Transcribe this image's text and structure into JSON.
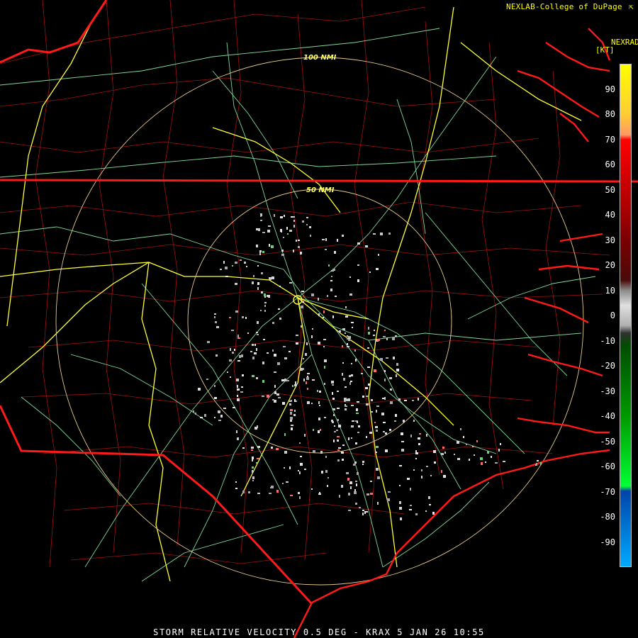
{
  "credit": "NEXLAB-College of DuPage",
  "credit_icon": "external-link-icon",
  "legend": {
    "product_label": "NEXRAD",
    "unit": "[KT]",
    "ticks": [
      90,
      80,
      70,
      60,
      50,
      40,
      30,
      20,
      10,
      0,
      -10,
      -20,
      -30,
      -40,
      -50,
      -60,
      -70,
      -80,
      -90
    ],
    "range_min": -100,
    "range_max": 100,
    "gradient_stops": [
      {
        "value": 100,
        "color": "#ffff00"
      },
      {
        "value": 80,
        "color": "#ffcc33"
      },
      {
        "value": 72,
        "color": "#ff9966"
      },
      {
        "value": 70,
        "color": "#ff0000"
      },
      {
        "value": 45,
        "color": "#b30000"
      },
      {
        "value": 30,
        "color": "#7a0000"
      },
      {
        "value": 14,
        "color": "#4a0a0a"
      },
      {
        "value": 10,
        "color": "#8a8a8a"
      },
      {
        "value": 4,
        "color": "#e0e0e0"
      },
      {
        "value": -4,
        "color": "#b0b0b0"
      },
      {
        "value": -7,
        "color": "#303030"
      },
      {
        "value": -12,
        "color": "#004d00"
      },
      {
        "value": -40,
        "color": "#009900"
      },
      {
        "value": -68,
        "color": "#00ff33"
      },
      {
        "value": -70,
        "color": "#0044aa"
      },
      {
        "value": -100,
        "color": "#00aaff"
      }
    ]
  },
  "range_rings": [
    {
      "label": "100 NMI"
    },
    {
      "label": "50 NMI"
    }
  ],
  "footer": "STORM RELATIVE VELOCITY 0.5 DEG - KRAX 5 JAN 26 10:55",
  "colors": {
    "state_borders": "#ff1a1a",
    "counties": "#b01010",
    "highways": "#ffff33",
    "roads": "#7fd99a",
    "range_rings": "#e6c98a",
    "echoes": "#c8c8c8"
  }
}
